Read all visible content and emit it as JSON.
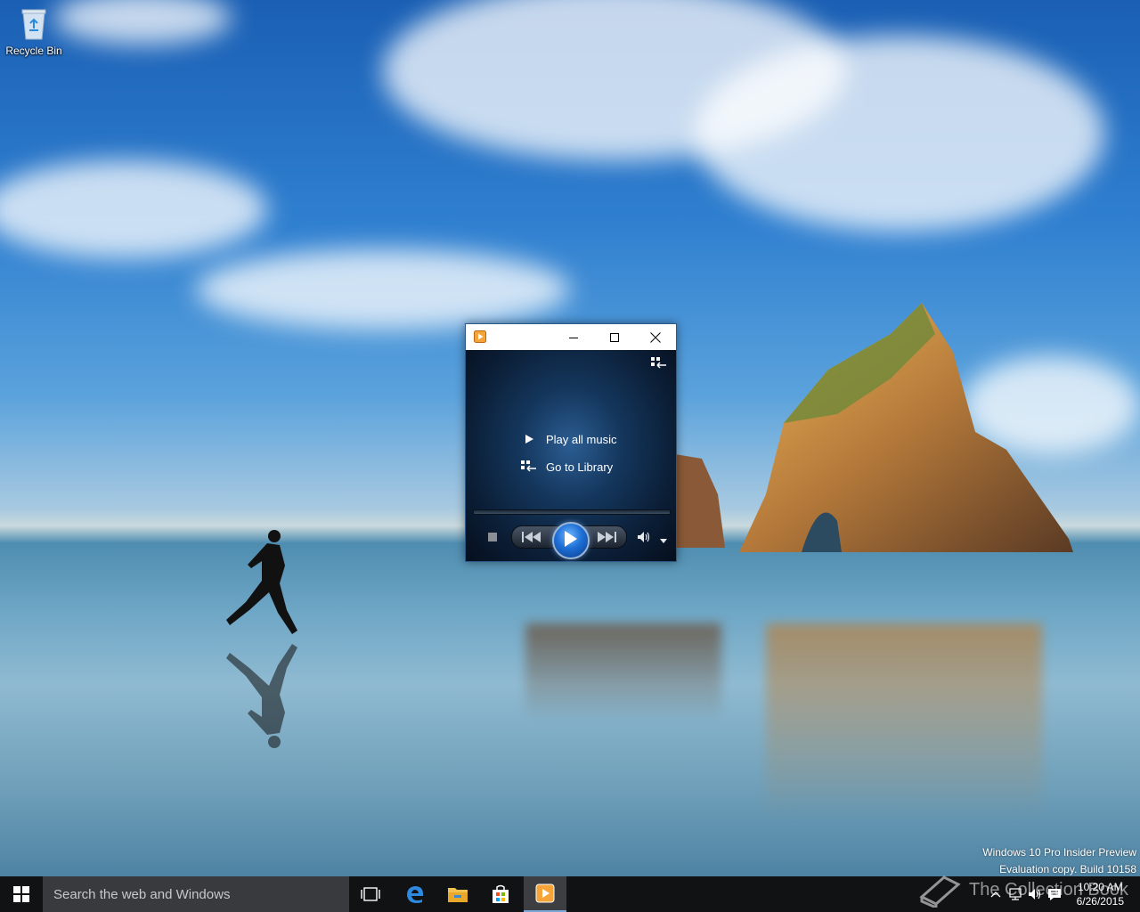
{
  "desktop": {
    "icons": [
      {
        "label": "Recycle Bin",
        "icon": "recycle-bin-icon"
      }
    ],
    "watermark": {
      "line1": "Windows 10 Pro Insider Preview",
      "line2": "Evaluation copy. Build 10158"
    },
    "credit": "The Collection Book"
  },
  "wmp": {
    "title_icon": "media-player-icon",
    "controls": {
      "minimize": "minimize-icon",
      "maximize": "maximize-icon",
      "close": "close-icon"
    },
    "menu": [
      {
        "label": "Play all music",
        "icon": "play-icon"
      },
      {
        "label": "Go to Library",
        "icon": "switch-to-library-icon"
      }
    ],
    "seek_progress": 0,
    "accent": "#1d6fd6"
  },
  "taskbar": {
    "search_placeholder": "Search the web and Windows",
    "pinned": [
      "task-view-icon",
      "edge-icon",
      "file-explorer-icon",
      "store-icon",
      "media-player-icon"
    ],
    "active": "media-player-icon",
    "tray_icons": [
      "chevron-up-icon",
      "network-icon",
      "volume-icon",
      "action-center-icon"
    ],
    "clock": {
      "time": "10:20 AM",
      "date": "6/26/2015"
    }
  }
}
